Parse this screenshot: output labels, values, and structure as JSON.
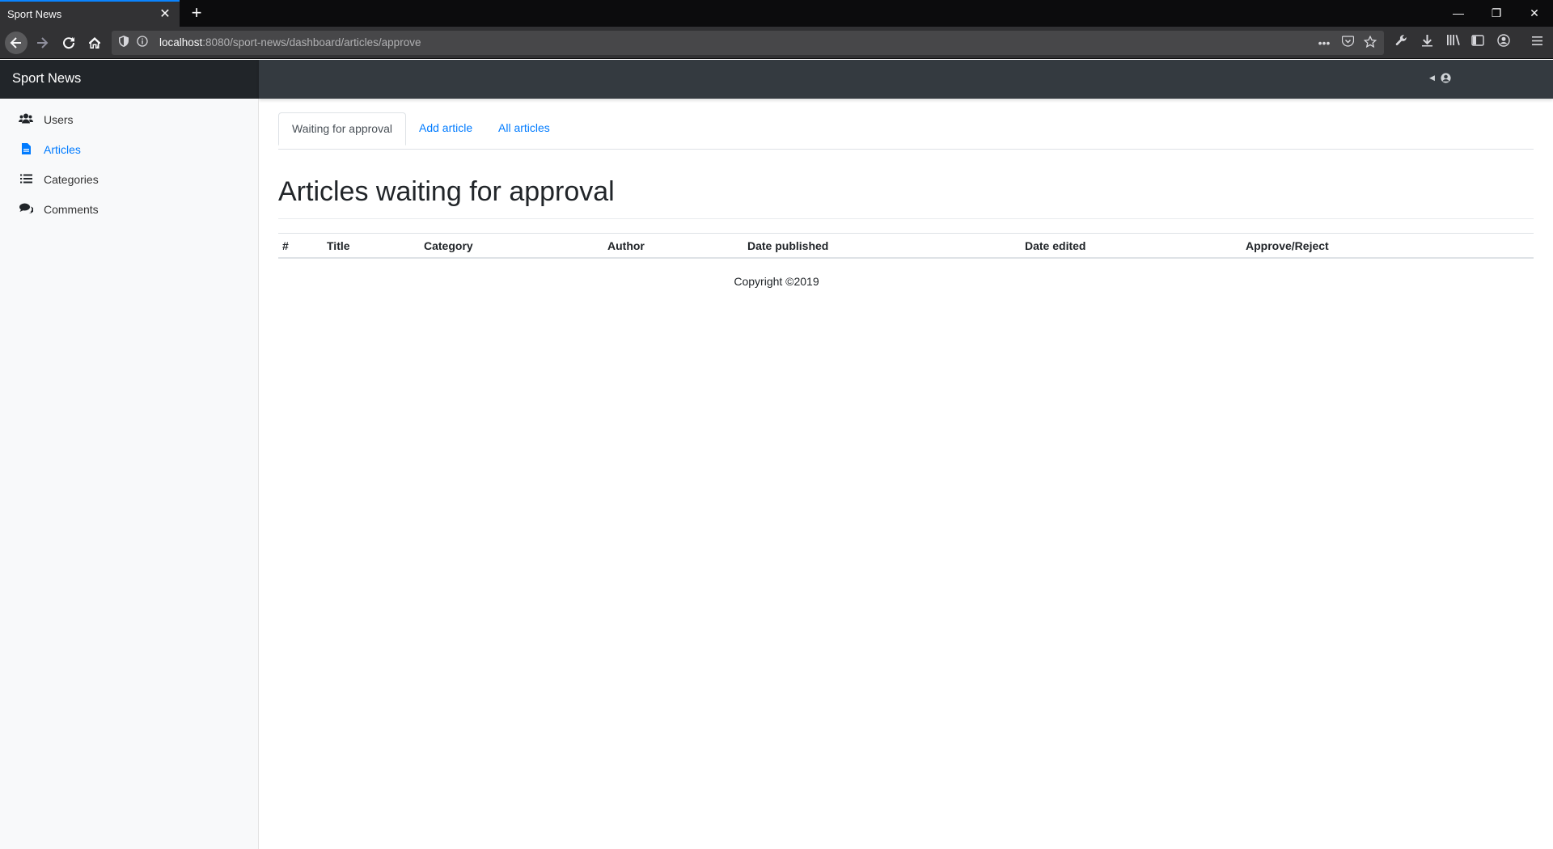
{
  "browser": {
    "tab_title": "Sport News",
    "tab_close": "✕",
    "new_tab": "+",
    "url_host": "localhost",
    "url_rest": ":8080/sport-news/dashboard/articles/approve",
    "window_controls": {
      "minimize": "—",
      "restore": "❐",
      "close": "✕"
    },
    "icons": {
      "back": "back-arrow-icon",
      "forward": "forward-arrow-icon",
      "reload": "reload-icon",
      "home": "home-icon",
      "shield": "tracking-protection-icon",
      "info": "site-info-icon",
      "more": "more-actions-icon",
      "pocket": "pocket-icon",
      "bookmark": "bookmark-star-icon",
      "tools": "wrench-icon",
      "download": "download-icon",
      "library": "library-icon",
      "sidebar": "sidebar-icon",
      "account": "account-icon",
      "menu": "hamburger-menu-icon"
    }
  },
  "app": {
    "brand": "Sport News",
    "user_menu_icon": "user-circle-icon",
    "sidebar": {
      "items": [
        {
          "label": "Users",
          "icon": "users-icon",
          "active": false
        },
        {
          "label": "Articles",
          "icon": "file-icon",
          "active": true
        },
        {
          "label": "Categories",
          "icon": "list-icon",
          "active": false
        },
        {
          "label": "Comments",
          "icon": "comments-icon",
          "active": false
        }
      ]
    },
    "tabs": [
      {
        "label": "Waiting for approval",
        "active": true
      },
      {
        "label": "Add article",
        "active": false
      },
      {
        "label": "All articles",
        "active": false
      }
    ],
    "page_title": "Articles waiting for approval",
    "table": {
      "columns": [
        "#",
        "Title",
        "Category",
        "Author",
        "Date published",
        "Date edited",
        "Approve/Reject"
      ],
      "rows": []
    },
    "footer": "Copyright ©2019"
  },
  "colors": {
    "accent": "#007bff",
    "brand_bg": "#212529",
    "topbar_bg": "#343a40",
    "sidebar_bg": "#f8f9fa"
  }
}
